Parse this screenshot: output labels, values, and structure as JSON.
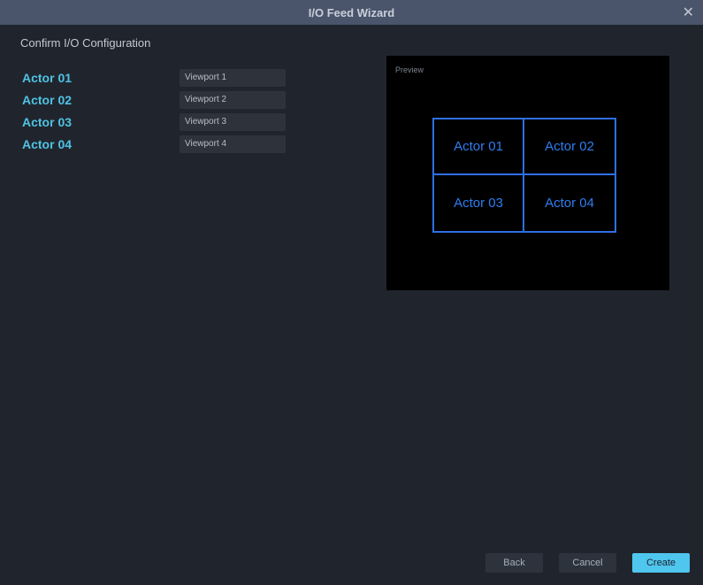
{
  "window": {
    "title": "I/O Feed Wizard",
    "close_glyph": "✕"
  },
  "heading": "Confirm I/O Configuration",
  "mappings": [
    {
      "actor": "Actor 01",
      "viewport": "Viewport 1"
    },
    {
      "actor": "Actor 02",
      "viewport": "Viewport 2"
    },
    {
      "actor": "Actor 03",
      "viewport": "Viewport 3"
    },
    {
      "actor": "Actor 04",
      "viewport": "Viewport 4"
    }
  ],
  "preview": {
    "label": "Preview",
    "cells": [
      "Actor 01",
      "Actor 02",
      "Actor 03",
      "Actor 04"
    ]
  },
  "buttons": {
    "back": "Back",
    "cancel": "Cancel",
    "create": "Create"
  },
  "colors": {
    "accent": "#4fc6ee",
    "preview_grid": "#2f6fe6"
  }
}
